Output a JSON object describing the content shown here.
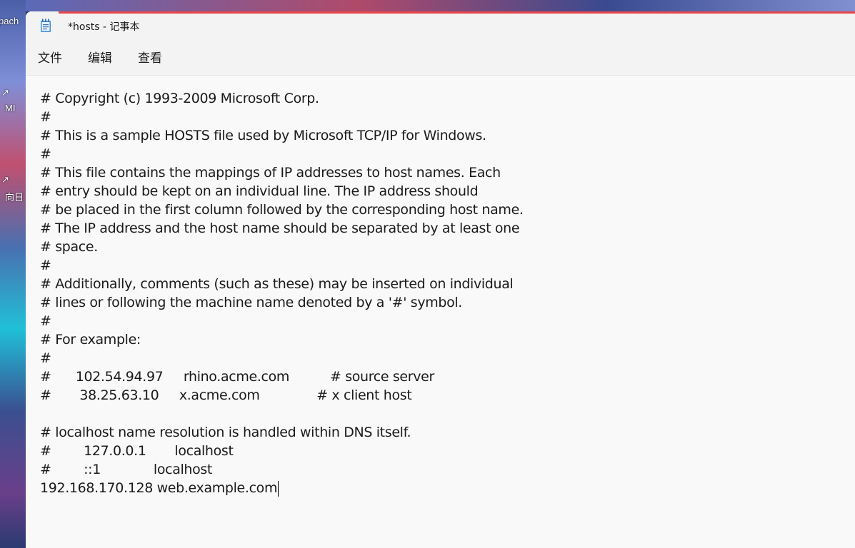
{
  "desktop": {
    "labels": [
      "pach",
      "MI",
      "向日"
    ]
  },
  "window": {
    "title": "*hosts - 记事本",
    "accent_color": "#e8464b",
    "app_icon": "notepad-icon"
  },
  "menu": {
    "file": "文件",
    "edit": "编辑",
    "view": "查看"
  },
  "editor": {
    "lines": [
      "# Copyright (c) 1993-2009 Microsoft Corp.",
      "#",
      "# This is a sample HOSTS file used by Microsoft TCP/IP for Windows.",
      "#",
      "# This file contains the mappings of IP addresses to host names. Each",
      "# entry should be kept on an individual line. The IP address should",
      "# be placed in the first column followed by the corresponding host name.",
      "# The IP address and the host name should be separated by at least one",
      "# space.",
      "#",
      "# Additionally, comments (such as these) may be inserted on individual",
      "# lines or following the machine name denoted by a '#' symbol.",
      "#",
      "# For example:",
      "#",
      "#      102.54.94.97     rhino.acme.com          # source server",
      "#       38.25.63.10     x.acme.com              # x client host",
      "",
      "# localhost name resolution is handled within DNS itself.",
      "#        127.0.0.1       localhost",
      "#        ::1             localhost",
      "192.168.170.128 web.example.com"
    ]
  }
}
